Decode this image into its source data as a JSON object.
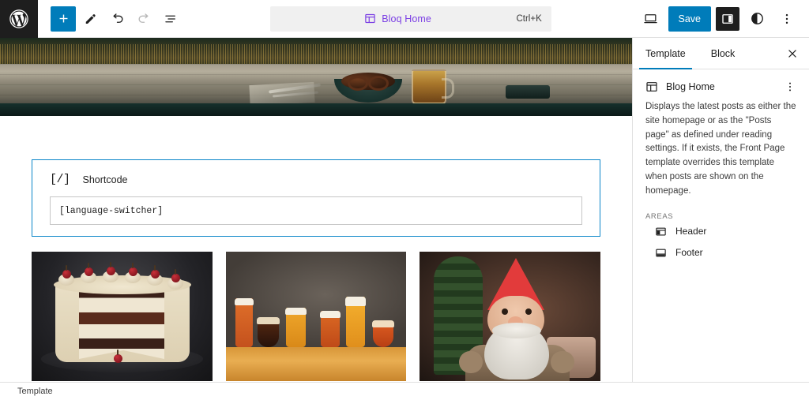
{
  "app": {
    "logo_icon": "wordpress-logo",
    "colors": {
      "accent": "#007cba",
      "template_purple": "#7b3fe4",
      "dark": "#1e1e1e"
    }
  },
  "toolbar": {
    "add_block_label": "+",
    "add_block_icon": "plus-icon",
    "edit_icon": "pencil-icon",
    "undo_icon": "undo-arrow-icon",
    "redo_icon": "redo-arrow-icon",
    "list_view_icon": "list-view-icon",
    "document_chip": {
      "icon": "template-layout-icon",
      "title": "Bloq Home",
      "shortcut": "Ctrl+K"
    },
    "view_icon": "desktop-preview-icon",
    "save_label": "Save",
    "settings_sidebar_icon": "settings-panel-icon",
    "styles_icon": "contrast-circle-icon",
    "options_icon": "three-dots-vertical-icon"
  },
  "canvas": {
    "hero": {
      "name": "hero-banner-image",
      "alt": "Pretzel in a dark bowl and a beer mug on a rustic wooden table with a wheat field behind"
    },
    "shortcode_block": {
      "icon": "shortcode-icon",
      "icon_glyph": "[/]",
      "label": "Shortcode",
      "value": "[language-switcher]",
      "selected": true
    },
    "gallery": [
      {
        "name": "gallery-image-cake",
        "alt": "Black Forest layer cake with cherries, sliced open on a dark plate"
      },
      {
        "name": "gallery-image-beers",
        "alt": "Six glasses of beer of different shapes on a wooden bar"
      },
      {
        "name": "gallery-image-gnome",
        "alt": "Garden gnome with a red pointed hat and white beard"
      }
    ]
  },
  "sidebar": {
    "tabs": [
      {
        "label": "Template",
        "active": true
      },
      {
        "label": "Block",
        "active": false
      }
    ],
    "close_icon": "close-x-icon",
    "template": {
      "icon": "template-layout-icon",
      "title": "Blog Home",
      "options_icon": "three-dots-vertical-icon",
      "description": "Displays the latest posts as either the site homepage or as the \"Posts page\" as defined under reading settings. If it exists, the Front Page template overrides this template when posts are shown on the homepage."
    },
    "areas_label": "AREAS",
    "areas": [
      {
        "label": "Header",
        "icon": "header-area-icon"
      },
      {
        "label": "Footer",
        "icon": "footer-area-icon"
      }
    ]
  },
  "footer": {
    "label": "Template"
  }
}
